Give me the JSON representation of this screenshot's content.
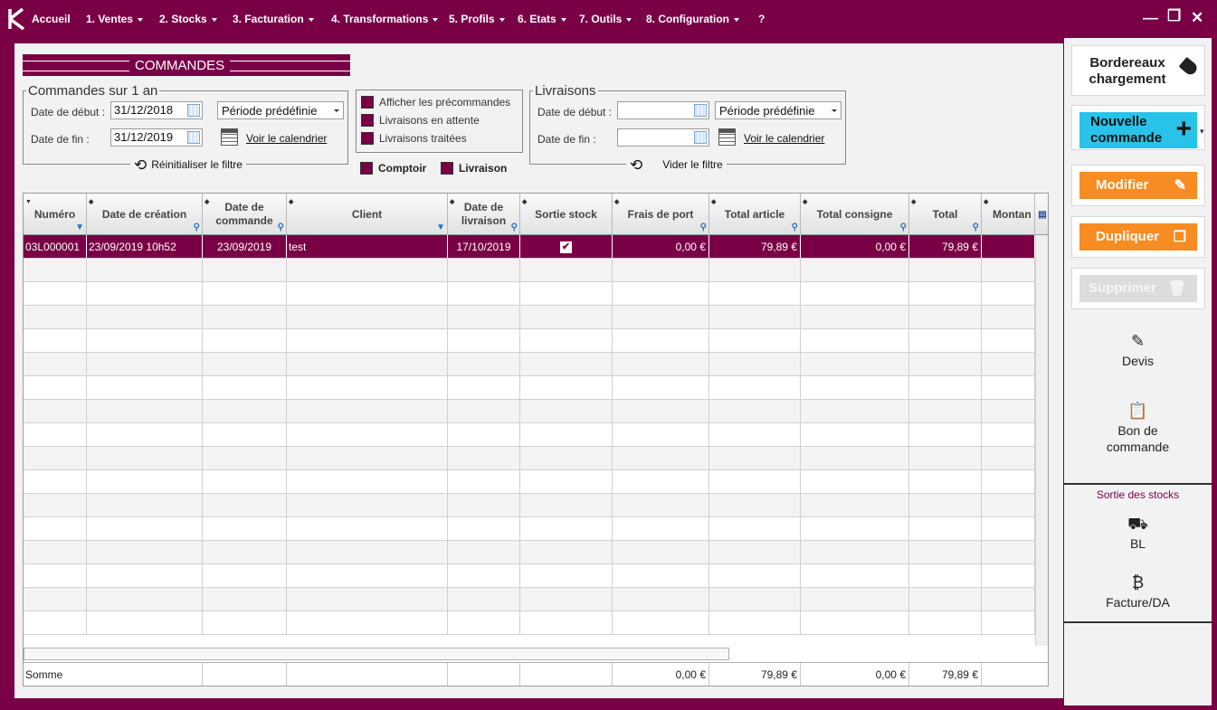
{
  "menu": {
    "items": [
      {
        "label": "Accueil",
        "caret": false
      },
      {
        "label": "1. Ventes",
        "caret": true
      },
      {
        "label": "2. Stocks",
        "caret": true
      },
      {
        "label": "3. Facturation",
        "caret": true
      },
      {
        "label": "4. Transformations",
        "caret": true
      },
      {
        "label": "5. Profils",
        "caret": true
      },
      {
        "label": "6. Etats",
        "caret": true
      },
      {
        "label": "7. Outils",
        "caret": true
      },
      {
        "label": "8. Configuration",
        "caret": true
      },
      {
        "label": "?",
        "caret": false
      }
    ],
    "window_controls": {
      "minimize": "—",
      "maximize": "❐",
      "close": "✕"
    }
  },
  "page": {
    "title": "COMMANDES"
  },
  "filter_orders": {
    "legend": "Commandes sur 1 an",
    "start_label": "Date de début :",
    "start_value": "31/12/2018",
    "end_label": "Date de fin :",
    "end_value": "31/12/2019",
    "period_select": "Période prédéfinie",
    "calendar_link": "Voir le calendrier",
    "reset_label": "Réinitialiser le filtre"
  },
  "checkboxes": {
    "precommandes": "Afficher les précommandes",
    "attente": "Livraisons en attente",
    "traitees": "Livraisons traitées",
    "comptoir": "Comptoir",
    "livraison": "Livraison"
  },
  "filter_deliveries": {
    "legend": "Livraisons",
    "start_label": "Date de début :",
    "start_value": "",
    "end_label": "Date de fin :",
    "end_value": "",
    "period_select": "Période prédéfinie",
    "calendar_link": "Voir le calendrier",
    "reset_label": "Vider le filtre"
  },
  "table": {
    "columns": [
      "Numéro",
      "Date de création",
      "Date de commande",
      "Client",
      "Date de livraison",
      "Sortie stock",
      "Frais de port",
      "Total article",
      "Total consigne",
      "Total",
      "Montan"
    ],
    "rows": [
      {
        "numero": "03L000001",
        "creation": "23/09/2019 10h52",
        "commande": "23/09/2019",
        "client": "test",
        "livraison": "17/10/2019",
        "sortie": "✔",
        "frais": "0,00 €",
        "article": "79,89 €",
        "consigne": "0,00 €",
        "total": "79,89 €",
        "montant": ""
      }
    ],
    "sum": {
      "label": "Somme",
      "frais": "0,00 €",
      "article": "79,89 €",
      "consigne": "0,00 €",
      "total": "79,89 €"
    }
  },
  "sidebar": {
    "bordereaux": "Bordereaux chargement",
    "nouvelle": "Nouvelle commande",
    "modifier": "Modifier",
    "dupliquer": "Dupliquer",
    "supprimer": "Supprimer",
    "devis": "Devis",
    "bon_commande": "Bon de commande",
    "section_stock": "Sortie des stocks",
    "bl": "BL",
    "facture": "Facture/DA"
  },
  "colors": {
    "brand": "#7a0046",
    "orange": "#f78c22",
    "cyan": "#29c2e8"
  },
  "icons": [
    "logo-k-icon",
    "tag-icon",
    "plus-icon",
    "pencil-icon",
    "copy-icon",
    "trash-icon",
    "edit-note-icon",
    "clipboard-icon",
    "truck-icon",
    "bitcoin-icon",
    "calendar-icon",
    "reset-icon"
  ]
}
